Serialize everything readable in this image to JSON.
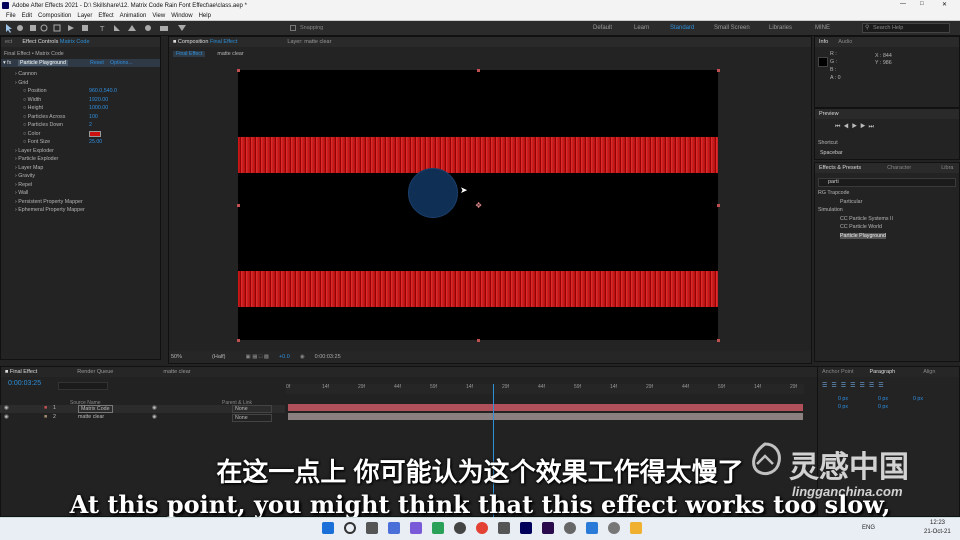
{
  "window": {
    "title": "Adobe After Effects 2021 - D:\\ Skillshare\\12. Matrix Code Rain Font Effect\\ae\\class.aep *"
  },
  "menu": [
    "File",
    "Edit",
    "Composition",
    "Layer",
    "Effect",
    "Animation",
    "View",
    "Window",
    "Help"
  ],
  "toolbar": {
    "snapping": "Snapping",
    "workspaces": [
      "Default",
      "Learn",
      "Standard",
      "Small Screen",
      "Libraries",
      "MINE"
    ],
    "search_placeholder": "Search Help"
  },
  "effect_controls": {
    "tab": "Effect Controls",
    "tab_layer": "Matrix Code",
    "subtitle": "Final Effect • Matrix Code",
    "effect_name": "Particle Playground",
    "reset": "Reset",
    "options": "Options...",
    "rows": [
      {
        "label": "Cannon",
        "value": ""
      },
      {
        "label": "Grid",
        "value": ""
      },
      {
        "label": "Position",
        "value": "960.0,540.0"
      },
      {
        "label": "Width",
        "value": "1920.00"
      },
      {
        "label": "Height",
        "value": "1000.00"
      },
      {
        "label": "Particles Across",
        "value": "100"
      },
      {
        "label": "Particles Down",
        "value": "2"
      },
      {
        "label": "Color",
        "value": ""
      },
      {
        "label": "Font Size",
        "value": "25.00"
      },
      {
        "label": "Layer Exploder",
        "value": ""
      },
      {
        "label": "Particle Exploder",
        "value": ""
      },
      {
        "label": "Layer Map",
        "value": ""
      },
      {
        "label": "Gravity",
        "value": ""
      },
      {
        "label": "Repel",
        "value": ""
      },
      {
        "label": "Wall",
        "value": ""
      },
      {
        "label": "Persistent Property Mapper",
        "value": ""
      },
      {
        "label": "Ephemeral Property Mapper",
        "value": ""
      }
    ],
    "color_swatch": "#cc1111"
  },
  "composition": {
    "tab": "Composition",
    "tab_comp": "Final Effect",
    "layer_tab": "Layer: matte clear",
    "crumbs": [
      "Final Effect",
      "matte clear"
    ],
    "zoom": "50%",
    "resolution": "(Half)",
    "exposure": "+0.0",
    "timecode": "0:00:03:25"
  },
  "info": {
    "tab": "Info",
    "tab2": "Audio",
    "r": "R :",
    "g": "G :",
    "b": "B :",
    "a": "A : 0",
    "x": "X : 844",
    "y": "Y : 986"
  },
  "preview": {
    "tab": "Preview",
    "shortcut_label": "Shortcut",
    "shortcut": "Spacebar"
  },
  "effects_presets": {
    "tab": "Effects & Presets",
    "tab2": "Character",
    "tab3": "Libra",
    "search": "parti",
    "tree": [
      {
        "label": "RG Trapcode",
        "indent": 0
      },
      {
        "label": "Particular",
        "indent": 1
      },
      {
        "label": "Simulation",
        "indent": 0
      },
      {
        "label": "CC Particle Systems II",
        "indent": 1
      },
      {
        "label": "CC Particle World",
        "indent": 1
      },
      {
        "label": "Particle Playground",
        "indent": 1
      }
    ]
  },
  "timeline": {
    "tabs": [
      "Final Effect",
      "Render Queue",
      "matte clear"
    ],
    "timecode": "0:00:03:25",
    "ruler": [
      "0f",
      "14f",
      "29f",
      "44f",
      "59f",
      "14f",
      "29f",
      "44f",
      "59f",
      "14f",
      "29f",
      "44f",
      "59f",
      "14f",
      "29f"
    ],
    "col_source": "Source Name",
    "col_parent": "Parent & Link",
    "layers": [
      {
        "num": "1",
        "name": "Matrix Code",
        "parent": "None"
      },
      {
        "num": "2",
        "name": "matte clear",
        "parent": "None"
      }
    ]
  },
  "paragraph": {
    "tab_anchor": "Anchor Point",
    "tab": "Paragraph",
    "tab2": "Align",
    "fields": [
      "0 px",
      "0 px",
      "0 px",
      "0 px",
      "0 px"
    ]
  },
  "subtitles": {
    "zh": "在这一点上 你可能认为这个效果工作得太慢了",
    "en": "At this point, you might think that this effect works too slow,"
  },
  "watermark": {
    "brand": "灵感中国",
    "url": "lingganchina.com"
  },
  "taskbar": {
    "lang": "ENG",
    "time": "12:23",
    "date": "21-Oct-21"
  }
}
